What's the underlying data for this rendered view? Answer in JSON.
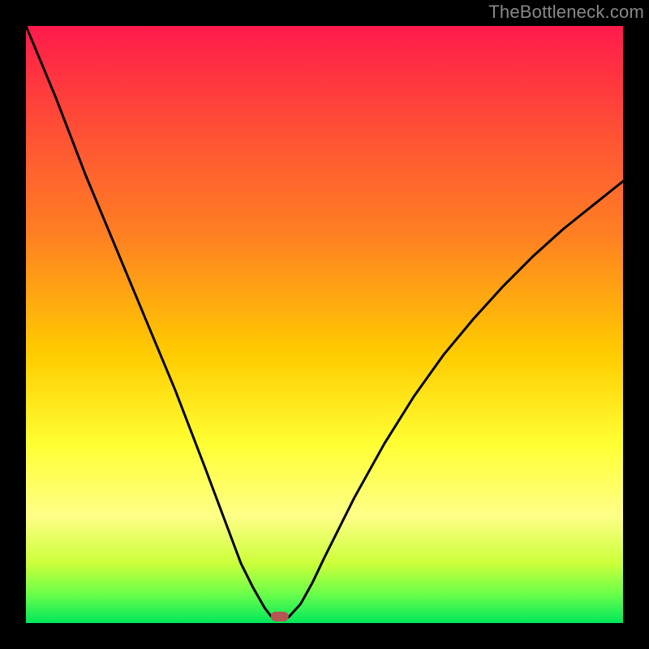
{
  "watermark": "TheBottleneck.com",
  "chart_data": {
    "type": "line",
    "title": "",
    "xlabel": "",
    "ylabel": "",
    "xlim": [
      0,
      100
    ],
    "ylim": [
      0,
      100
    ],
    "x": [
      0,
      5,
      10,
      15,
      20,
      25,
      30,
      33,
      36,
      38,
      40,
      41,
      42,
      43,
      44,
      46,
      48,
      50,
      55,
      60,
      65,
      70,
      75,
      80,
      85,
      90,
      95,
      100
    ],
    "y": [
      100,
      88,
      75,
      63,
      51,
      39,
      26,
      18,
      10,
      6,
      2.5,
      1.2,
      0.5,
      0.5,
      1,
      3.2,
      6.8,
      11,
      21,
      30,
      38,
      45,
      51,
      56.5,
      61.5,
      66,
      70,
      74
    ],
    "minimum_x": 42.5,
    "minimum_y": 0,
    "marker": {
      "color": "#a94444",
      "shape": "rounded-rect"
    },
    "gradient_legend_implied": "red (top) = high bottleneck, green (bottom) = balanced"
  }
}
